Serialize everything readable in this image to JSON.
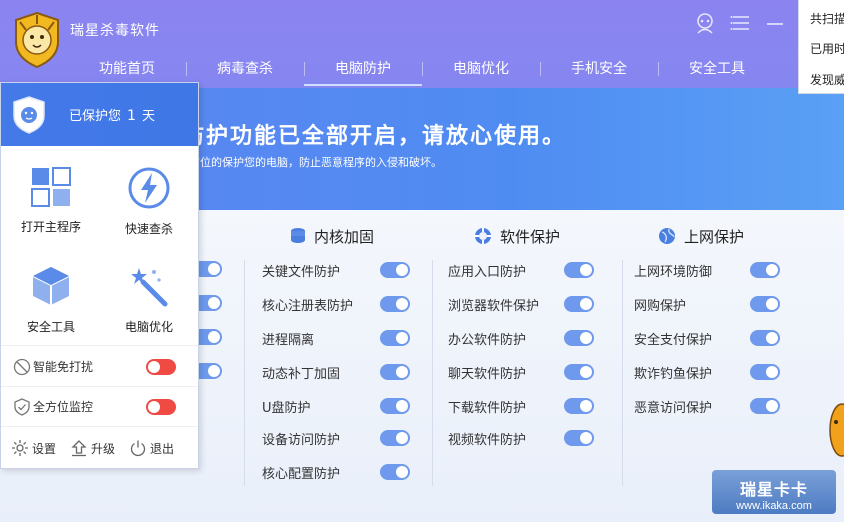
{
  "app": {
    "title": "瑞星杀毒软件"
  },
  "nav": [
    {
      "label": "功能首页"
    },
    {
      "label": "病毒查杀"
    },
    {
      "label": "电脑防护",
      "active": true
    },
    {
      "label": "电脑优化"
    },
    {
      "label": "手机安全"
    },
    {
      "label": "安全工具"
    }
  ],
  "banner": {
    "title": "电脑防护功能已全部开启，请放心使用。",
    "subtitle": "，瑞星将全方位的保护您的电脑，防止恶意程序的入侵和破坏。"
  },
  "columns": [
    {
      "title": "内核加固",
      "icon": "database-icon",
      "items": [
        "关键文件防护",
        "核心注册表防护",
        "进程隔离",
        "动态补丁加固",
        "U盘防护",
        "设备访问防护",
        "核心配置防护"
      ]
    },
    {
      "title": "软件保护",
      "icon": "lifebuoy-icon",
      "items": [
        "应用入口防护",
        "浏览器软件保护",
        "办公软件防护",
        "聊天软件防护",
        "下载软件防护",
        "视频软件防护"
      ]
    },
    {
      "title": "上网保护",
      "icon": "globe-icon",
      "items": [
        "上网环境防御",
        "网购保护",
        "安全支付保护",
        "欺诈钓鱼保护",
        "恶意访问保护"
      ]
    }
  ],
  "popup": {
    "protect_prefix": "已保护您",
    "protect_days": "1",
    "protect_suffix": "天",
    "tiles": [
      {
        "label": "打开主程序",
        "icon": "grid-icon"
      },
      {
        "label": "快速查杀",
        "icon": "lightning-icon"
      },
      {
        "label": "安全工具",
        "icon": "box-icon"
      },
      {
        "label": "电脑优化",
        "icon": "magic-wand-icon"
      }
    ],
    "options": [
      {
        "label": "智能免打扰",
        "icon": "no-disturb-icon",
        "on": false
      },
      {
        "label": "全方位监控",
        "icon": "shield-check-icon",
        "on": false
      }
    ],
    "footer": [
      {
        "label": "设置",
        "icon": "gear-icon"
      },
      {
        "label": "升级",
        "icon": "upload-icon"
      },
      {
        "label": "退出",
        "icon": "power-icon"
      }
    ]
  },
  "tooltip": {
    "lines": [
      "共扫描",
      "已用时",
      "发现威"
    ]
  },
  "watermark": {
    "brand": "瑞星卡卡",
    "url": "www.ikaka.com"
  },
  "colors": {
    "toggle_on": "#6e99ec",
    "toggle_off": "#f04a44",
    "header_blue": "#4479e8"
  }
}
